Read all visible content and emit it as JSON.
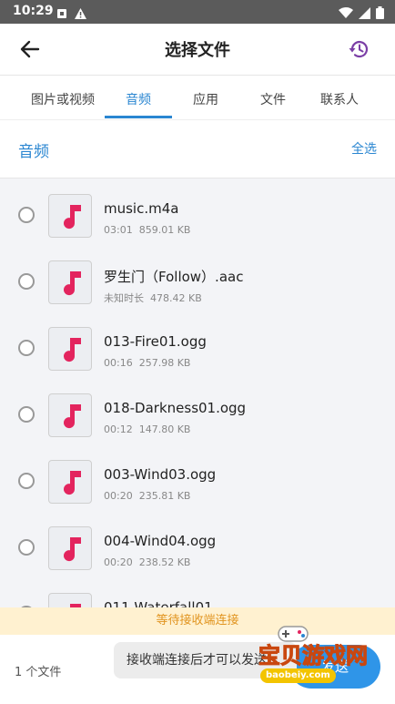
{
  "status_bar": {
    "time": "10:29"
  },
  "app_bar": {
    "title": "选择文件"
  },
  "tabs": [
    {
      "label": "图片或视频"
    },
    {
      "label": "音频"
    },
    {
      "label": "应用"
    },
    {
      "label": "文件"
    },
    {
      "label": "联系人"
    }
  ],
  "active_tab": "音频",
  "section": {
    "title": "音频",
    "select_all": "全选"
  },
  "files": [
    {
      "name": "music.m4a",
      "duration": "03:01",
      "size": "859.01 KB"
    },
    {
      "name": "罗生门（Follow）.aac",
      "duration": "未知时长",
      "size": "478.42 KB"
    },
    {
      "name": "013-Fire01.ogg",
      "duration": "00:16",
      "size": "257.98 KB"
    },
    {
      "name": "018-Darkness01.ogg",
      "duration": "00:12",
      "size": "147.80 KB"
    },
    {
      "name": "003-Wind03.ogg",
      "duration": "00:20",
      "size": "235.81 KB"
    },
    {
      "name": "004-Wind04.ogg",
      "duration": "00:20",
      "size": "238.52 KB"
    },
    {
      "name": "011-Waterfall01",
      "duration": "",
      "size": ""
    }
  ],
  "banner": {
    "text": "等待接收端连接"
  },
  "bottom": {
    "file_count": "1 个文件",
    "toast": "接收端连接后才可以发送",
    "send_label": "发送"
  },
  "watermark": {
    "text": "宝贝游戏网",
    "url": "baobeiy.com"
  },
  "colors": {
    "accent": "#2a86d1",
    "music_icon": "#e3245e",
    "history_icon": "#7b3fa6",
    "banner_bg": "#fff1d0",
    "banner_text": "#e1941f"
  }
}
